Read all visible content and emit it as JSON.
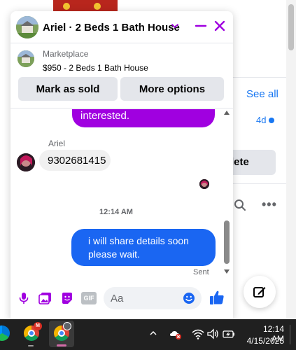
{
  "background": {
    "see_all_label": "See all",
    "time_label": "4d",
    "delete_label": "lete",
    "more_label": "•••"
  },
  "chat": {
    "title": "Ariel · 2 Beds 1 Bath House",
    "listing": {
      "source": "Marketplace",
      "title": "$950 - 2 Beds 1 Bath House"
    },
    "actions": {
      "mark_sold_label": "Mark as sold",
      "more_options_label": "More options"
    },
    "messages": {
      "partial_outgoing_text": "interested.",
      "sender_name": "Ariel",
      "incoming_text": "9302681415",
      "timestamp": "12:14 AM",
      "outgoing_text": "i will share details soon please wait.",
      "status": "Sent"
    },
    "composer": {
      "placeholder": "Aa",
      "gif_label": "GIF"
    },
    "colors": {
      "accent": "#a000e0",
      "outgoing_bubble": "#1a66f2",
      "purple_bubble": "#a000e0"
    }
  },
  "taskbar": {
    "badge": "M",
    "clock_time": "12:14 AM",
    "clock_date": "4/15/2025"
  }
}
